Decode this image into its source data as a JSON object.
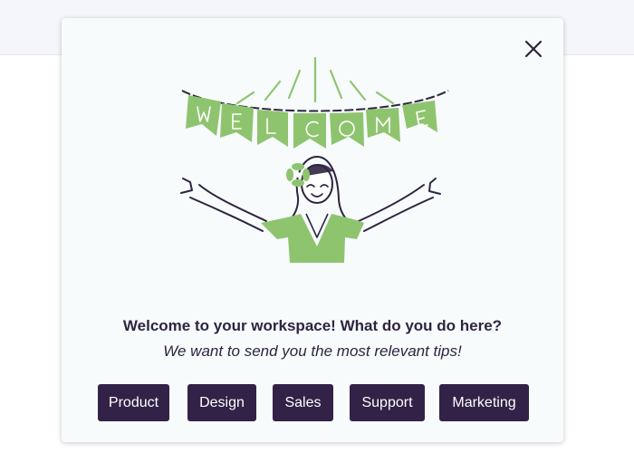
{
  "modal": {
    "title": "Welcome to your workspace! What do you do here?",
    "subtitle": "We want to send you the most relevant tips!",
    "banner_text": "WELCOME",
    "close_icon": "close-icon"
  },
  "buttons": {
    "product": "Product",
    "design": "Design",
    "sales": "Sales",
    "support": "Support",
    "marketing": "Marketing"
  },
  "colors": {
    "accent_green": "#8fc46f",
    "button_bg": "#332247",
    "text": "#2e2440"
  }
}
